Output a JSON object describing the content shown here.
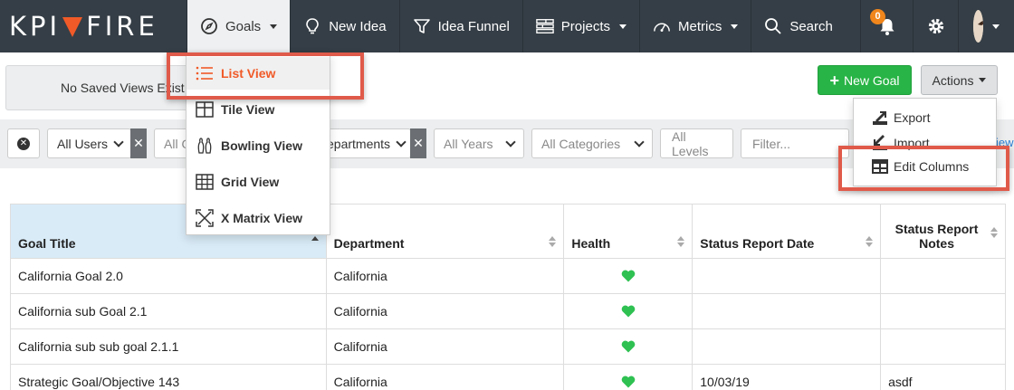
{
  "brand": {
    "logo_left": "KPI",
    "logo_right": "FIRE"
  },
  "nav": {
    "goals": "Goals",
    "new_idea": "New Idea",
    "idea_funnel": "Idea Funnel",
    "projects": "Projects",
    "metrics": "Metrics",
    "search": "Search",
    "notifications_count": "0"
  },
  "toolbar": {
    "saved_views": "No Saved Views Exist",
    "new_goal": "New Goal",
    "actions": "Actions"
  },
  "goals_menu": {
    "items": [
      {
        "label": "List View",
        "icon": "list-icon"
      },
      {
        "label": "Tile View",
        "icon": "tile-icon"
      },
      {
        "label": "Bowling View",
        "icon": "bowling-pins-icon"
      },
      {
        "label": "Grid View",
        "icon": "grid-icon"
      },
      {
        "label": "X Matrix View",
        "icon": "x-matrix-icon"
      }
    ]
  },
  "actions_menu": {
    "items": [
      {
        "label": "Export",
        "icon": "export-icon"
      },
      {
        "label": "Import",
        "icon": "import-icon"
      },
      {
        "label": "Edit Columns",
        "icon": "table-icon"
      }
    ]
  },
  "filters": {
    "users": "All Users",
    "second": "All O",
    "departments": "epartments",
    "years": "All Years",
    "categories": "All Categories",
    "levels": "All Levels",
    "filter_placeholder": "Filter...",
    "link_fragment": "iew"
  },
  "table": {
    "headers": [
      "Goal Title",
      "Department",
      "Health",
      "Status Report Date",
      "Status Report Notes"
    ],
    "rows": [
      {
        "title": "California Goal 2.0",
        "department": "California",
        "health": "green",
        "date": "",
        "notes": ""
      },
      {
        "title": "California sub Goal 2.1",
        "department": "California",
        "health": "green",
        "date": "",
        "notes": ""
      },
      {
        "title": "California sub sub goal 2.1.1",
        "department": "California",
        "health": "green",
        "date": "",
        "notes": ""
      },
      {
        "title": "Strategic Goal/Objective 143",
        "department": "California",
        "health": "green",
        "date": "10/03/19",
        "notes": "asdf"
      }
    ]
  },
  "colors": {
    "navbar": "#353e46",
    "accent": "#f05a28",
    "success": "#28b446",
    "highlight": "#e05a4a",
    "health_green": "#2fc152"
  }
}
